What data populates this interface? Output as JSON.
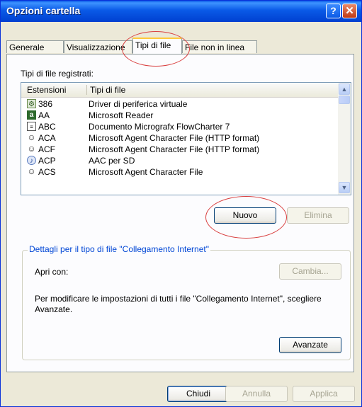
{
  "window": {
    "title": "Opzioni cartella"
  },
  "titlebar_buttons": {
    "help": "?",
    "close": "✕"
  },
  "tabs": [
    {
      "label": "Generale"
    },
    {
      "label": "Visualizzazione"
    },
    {
      "label": "Tipi di file"
    },
    {
      "label": "File non in linea"
    }
  ],
  "filetypes": {
    "label": "Tipi di file registrati:",
    "columns": [
      "Estensioni",
      "Tipi di file"
    ],
    "rows": [
      {
        "ext": "386",
        "type": "Driver di periferica virtuale",
        "icon": "driver-icon"
      },
      {
        "ext": "AA",
        "type": "Microsoft Reader",
        "icon": "reader-icon"
      },
      {
        "ext": "ABC",
        "type": "Documento Micrografx FlowCharter 7",
        "icon": "flowchart-icon"
      },
      {
        "ext": "ACA",
        "type": "Microsoft Agent Character File (HTTP format)",
        "icon": "agent-icon"
      },
      {
        "ext": "ACF",
        "type": "Microsoft Agent Character File (HTTP format)",
        "icon": "agent-icon"
      },
      {
        "ext": "ACP",
        "type": "AAC per SD",
        "icon": "audio-icon"
      },
      {
        "ext": "ACS",
        "type": "Microsoft Agent Character File",
        "icon": "agent-icon"
      }
    ]
  },
  "buttons": {
    "new": "Nuovo",
    "delete": "Elimina",
    "change": "Cambia...",
    "advanced": "Avanzate",
    "close": "Chiudi",
    "cancel": "Annulla",
    "apply": "Applica"
  },
  "details": {
    "title": "Dettagli per il tipo di file \"Collegamento Internet\"",
    "opens_with_label": "Apri con:",
    "description": "Per modificare le impostazioni di tutti i file \"Collegamento Internet\", scegliere Avanzate."
  },
  "colors": {
    "titlebar": "#0a5ae7",
    "dialog": "#ece9d8",
    "group_title": "#0046d5",
    "annotation": "#d94040"
  }
}
